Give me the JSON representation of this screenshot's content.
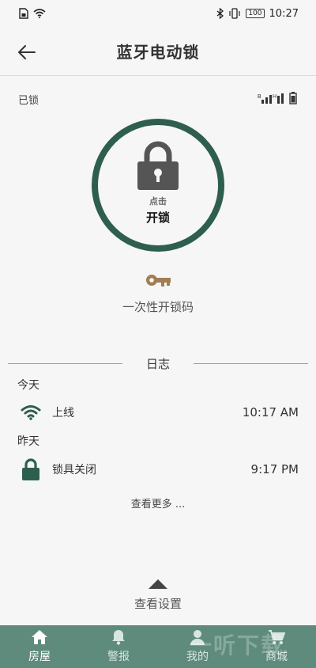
{
  "statusbar": {
    "time": "10:27",
    "battery": "100"
  },
  "header": {
    "title": "蓝牙电动锁"
  },
  "lock": {
    "state": "已锁",
    "hint": "点击",
    "action": "开锁"
  },
  "otp": {
    "label": "一次性开锁码"
  },
  "log": {
    "title": "日志",
    "groups": [
      {
        "day": "今天",
        "entries": [
          {
            "icon": "wifi-icon",
            "event": "上线",
            "time": "10:17 AM"
          }
        ]
      },
      {
        "day": "昨天",
        "entries": [
          {
            "icon": "lock-icon",
            "event": "锁具关闭",
            "time": "9:17 PM"
          }
        ]
      }
    ],
    "more": "查看更多 ..."
  },
  "settings": {
    "label": "查看设置"
  },
  "nav": {
    "items": [
      {
        "label": "房屋",
        "icon": "home-icon",
        "active": true
      },
      {
        "label": "警报",
        "icon": "bell-icon",
        "active": false
      },
      {
        "label": "我的",
        "icon": "user-icon",
        "active": false
      },
      {
        "label": "商城",
        "icon": "cart-icon",
        "active": false
      }
    ]
  },
  "colors": {
    "accent": "#2e5e4e",
    "nav_bg": "#5f8b7c",
    "key": "#a07e52",
    "lock_gray": "#555555"
  },
  "watermark": "一听下载"
}
